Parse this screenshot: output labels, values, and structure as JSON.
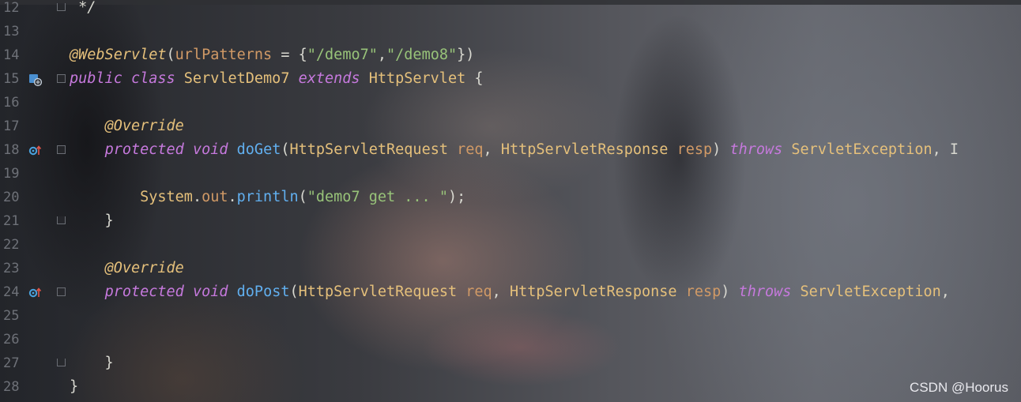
{
  "editor": {
    "lines": [
      {
        "num": "12",
        "tokens": [
          {
            "t": " */",
            "c": "cmt"
          }
        ]
      },
      {
        "num": "13",
        "tokens": []
      },
      {
        "num": "14",
        "tokens": [
          {
            "t": "@WebServlet",
            "c": "ann"
          },
          {
            "t": "(",
            "c": "pun"
          },
          {
            "t": "urlPatterns",
            "c": "attr"
          },
          {
            "t": " = {",
            "c": "pun"
          },
          {
            "t": "\"/demo7\"",
            "c": "str"
          },
          {
            "t": ",",
            "c": "pun"
          },
          {
            "t": "\"/demo8\"",
            "c": "str"
          },
          {
            "t": "})",
            "c": "pun"
          }
        ]
      },
      {
        "num": "15",
        "tokens": [
          {
            "t": "public ",
            "c": "kw"
          },
          {
            "t": "class ",
            "c": "kw"
          },
          {
            "t": "ServletDemo7 ",
            "c": "cls"
          },
          {
            "t": "extends ",
            "c": "kw"
          },
          {
            "t": "HttpServlet",
            "c": "cls"
          },
          {
            "t": " {",
            "c": "pun"
          }
        ]
      },
      {
        "num": "16",
        "tokens": []
      },
      {
        "num": "17",
        "tokens": [
          {
            "t": "    ",
            "c": "pun"
          },
          {
            "t": "@Override",
            "c": "ann"
          }
        ]
      },
      {
        "num": "18",
        "tokens": [
          {
            "t": "    ",
            "c": "pun"
          },
          {
            "t": "protected ",
            "c": "kw"
          },
          {
            "t": "void ",
            "c": "kw"
          },
          {
            "t": "doGet",
            "c": "fn"
          },
          {
            "t": "(",
            "c": "pun"
          },
          {
            "t": "HttpServletRequest ",
            "c": "cls"
          },
          {
            "t": "req",
            "c": "prm"
          },
          {
            "t": ", ",
            "c": "pun"
          },
          {
            "t": "HttpServletResponse ",
            "c": "cls"
          },
          {
            "t": "resp",
            "c": "prm"
          },
          {
            "t": ") ",
            "c": "pun"
          },
          {
            "t": "throws ",
            "c": "kw"
          },
          {
            "t": "ServletException",
            "c": "cls"
          },
          {
            "t": ", I",
            "c": "pun"
          }
        ]
      },
      {
        "num": "19",
        "tokens": []
      },
      {
        "num": "20",
        "tokens": [
          {
            "t": "        ",
            "c": "pun"
          },
          {
            "t": "System",
            "c": "cls"
          },
          {
            "t": ".",
            "c": "pun"
          },
          {
            "t": "out",
            "c": "fld"
          },
          {
            "t": ".",
            "c": "pun"
          },
          {
            "t": "println",
            "c": "fn"
          },
          {
            "t": "(",
            "c": "pun"
          },
          {
            "t": "\"demo7 get ... \"",
            "c": "str"
          },
          {
            "t": ");",
            "c": "pun"
          }
        ]
      },
      {
        "num": "21",
        "tokens": [
          {
            "t": "    }",
            "c": "pun"
          }
        ]
      },
      {
        "num": "22",
        "tokens": []
      },
      {
        "num": "23",
        "tokens": [
          {
            "t": "    ",
            "c": "pun"
          },
          {
            "t": "@Override",
            "c": "ann"
          }
        ]
      },
      {
        "num": "24",
        "tokens": [
          {
            "t": "    ",
            "c": "pun"
          },
          {
            "t": "protected ",
            "c": "kw"
          },
          {
            "t": "void ",
            "c": "kw"
          },
          {
            "t": "doPost",
            "c": "fn"
          },
          {
            "t": "(",
            "c": "pun"
          },
          {
            "t": "HttpServletRequest ",
            "c": "cls"
          },
          {
            "t": "req",
            "c": "prm"
          },
          {
            "t": ", ",
            "c": "pun"
          },
          {
            "t": "HttpServletResponse ",
            "c": "cls"
          },
          {
            "t": "resp",
            "c": "prm"
          },
          {
            "t": ") ",
            "c": "pun"
          },
          {
            "t": "throws ",
            "c": "kw"
          },
          {
            "t": "ServletException",
            "c": "cls"
          },
          {
            "t": ",",
            "c": "pun"
          }
        ]
      },
      {
        "num": "25",
        "tokens": []
      },
      {
        "num": "26",
        "tokens": []
      },
      {
        "num": "27",
        "tokens": [
          {
            "t": "    }",
            "c": "pun"
          }
        ]
      },
      {
        "num": "28",
        "tokens": [
          {
            "t": "}",
            "c": "pun"
          }
        ]
      }
    ],
    "gutter_icons": {
      "15": "servlet-class-icon",
      "18": "override-method-icon",
      "24": "override-method-icon"
    },
    "fold_markers": {
      "12": "end",
      "15": "start",
      "18": "start",
      "21": "end",
      "24": "start",
      "27": "end"
    }
  },
  "colors": {
    "keyword": "#c679dd",
    "class_name": "#e5c07b",
    "string": "#98c379",
    "method": "#61afef",
    "param": "#d19a66",
    "line_number": "#6e7178"
  },
  "watermark": "CSDN @Hoorus"
}
